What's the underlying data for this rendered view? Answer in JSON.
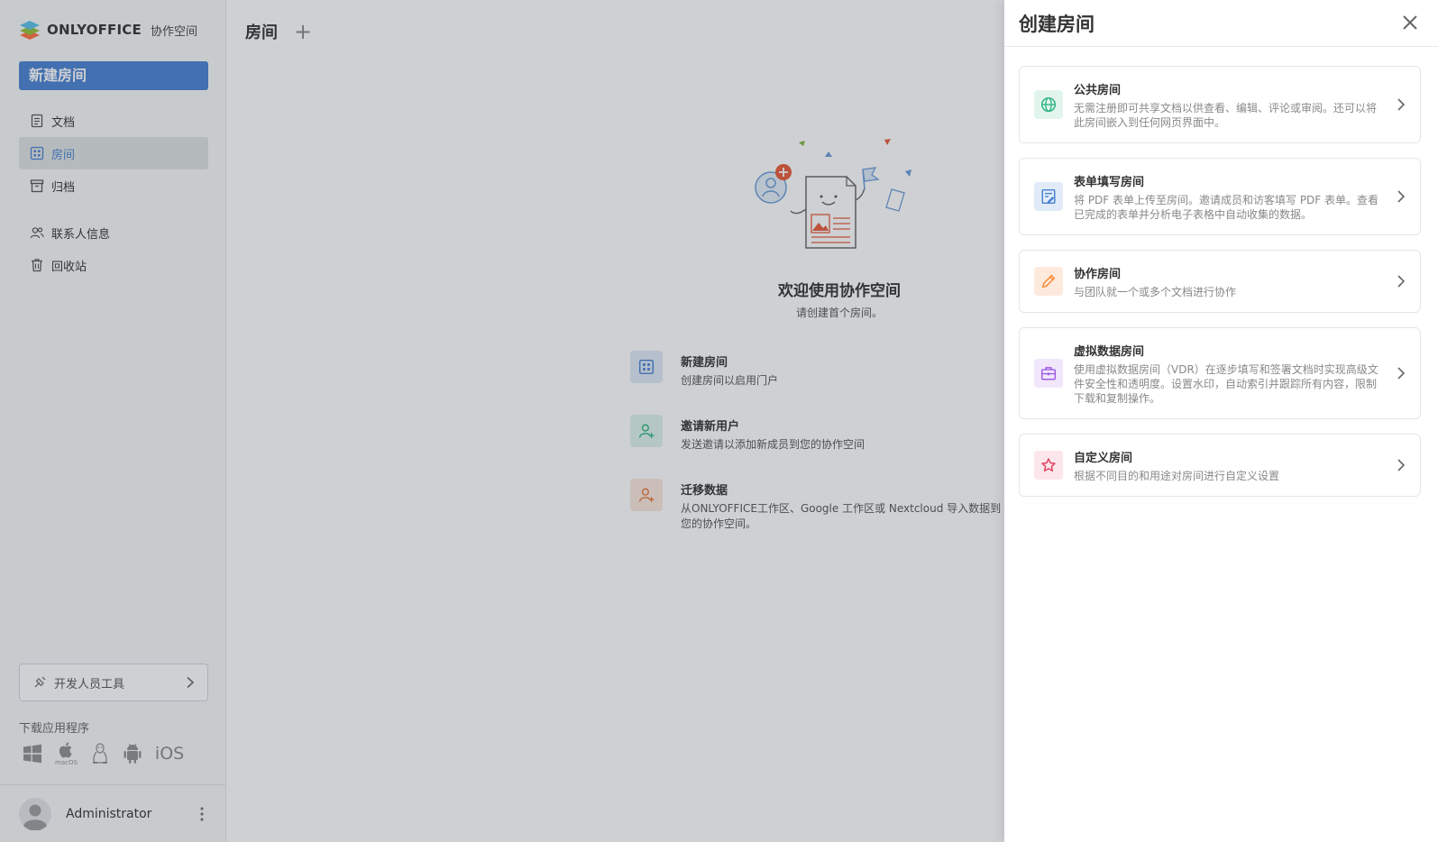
{
  "sidebar": {
    "brand": "ONLYOFFICE",
    "brand_sub": "协作空间",
    "new_room_button": "新建房间",
    "nav": {
      "documents": "文档",
      "rooms": "房间",
      "archive": "归档",
      "contacts": "联系人信息",
      "trash": "回收站"
    },
    "dev_tools": "开发人员工具",
    "download_label": "下载应用程序",
    "macos_label": "macOS",
    "ios_label": "iOS",
    "user_name": "Administrator"
  },
  "main": {
    "title": "房间",
    "welcome_title": "欢迎使用协作空间",
    "welcome_subtitle": "请创建首个房间。",
    "actions": [
      {
        "title": "新建房间",
        "desc": "创建房间以启用门户"
      },
      {
        "title": "邀请新用户",
        "desc": "发送邀请以添加新成员到您的协作空间"
      },
      {
        "title": "迁移数据",
        "desc": "从ONLYOFFICE工作区、Google 工作区或 Nextcloud 导入数据到您的协作空间。"
      }
    ]
  },
  "panel": {
    "title": "创建房间",
    "rooms": [
      {
        "title": "公共房间",
        "desc": "无需注册即可共享文档以供查看、编辑、评论或审阅。还可以将此房间嵌入到任何网页界面中。"
      },
      {
        "title": "表单填写房间",
        "desc": "将 PDF 表单上传至房间。邀请成员和访客填写 PDF 表单。查看已完成的表单并分析电子表格中自动收集的数据。"
      },
      {
        "title": "协作房间",
        "desc": "与团队就一个或多个文档进行协作"
      },
      {
        "title": "虚拟数据房间",
        "desc": "使用虚拟数据房间（VDR）在逐步填写和签署文档时实现高级文件安全性和透明度。设置水印，自动索引并跟踪所有内容，限制下载和复制操作。"
      },
      {
        "title": "自定义房间",
        "desc": "根据不同目的和用途对房间进行自定义设置"
      }
    ]
  },
  "colors": {
    "accent": "#4781d1",
    "public_room": "#2db482",
    "form_room": "#4781d1",
    "collab_room": "#ff8932",
    "vdr_room": "#9d5be3",
    "custom_room": "#e04162"
  }
}
